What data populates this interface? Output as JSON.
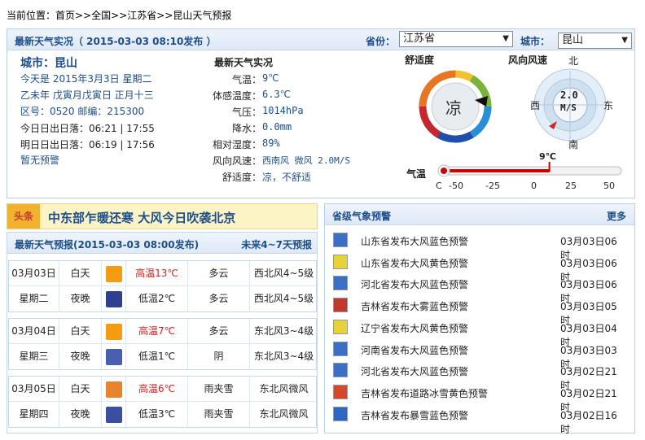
{
  "breadcrumb": {
    "prefix": "当前位置：",
    "home": "首页",
    "sep": ">>",
    "nation": "全国",
    "province": "江苏省",
    "page": "昆山天气预报"
  },
  "realtime": {
    "header": "最新天气实况（ 2015-03-03  08:10发布 ）",
    "province_label": "省份：",
    "province_value": "江苏省",
    "city_label": "城市：",
    "city_value": "昆山",
    "city_title": "城市：昆山",
    "info": [
      "今天是 2015年3月3日 星期二",
      "乙未年 戊寅月戊寅日 正月十三",
      "区号：0520  邮编：215300",
      "今日日出日落：06:21 | 17:55",
      "明日日出日落：06:19 | 17:56",
      "暂无预警"
    ],
    "obs_title": "最新天气实况",
    "obs": [
      {
        "k": "气温：",
        "v": "9℃"
      },
      {
        "k": "体感温度：",
        "v": "6.3℃"
      },
      {
        "k": "气压：",
        "v": "1014hPa"
      },
      {
        "k": "降水：",
        "v": "0.0mm"
      },
      {
        "k": "相对湿度：",
        "v": "89%"
      },
      {
        "k": "风向风速：",
        "v": "西南风 微风 2.0M/S"
      },
      {
        "k": "舒适度：",
        "v": "凉，不舒适"
      }
    ],
    "comfort_title": "舒适度",
    "comfort_value": "凉",
    "wind_title": "风向风速",
    "wind_value": "2.0",
    "wind_unit": "M/S",
    "compass": {
      "n": "北",
      "s": "南",
      "e": "东",
      "w": "西"
    },
    "temp_label": "气温",
    "temp_now": "9℃",
    "temp_now_value": 9,
    "temp_ticks": [
      "C",
      "-50",
      "-25",
      "0",
      "25",
      "50"
    ],
    "colors": {
      "header_text": "#1d4e8a",
      "high": "#d21f1f",
      "gauge_red": "#cc0000"
    }
  },
  "headline": {
    "tag": "头条",
    "text": "中东部乍暖还寒  大风今日吹袭北京"
  },
  "forecast": {
    "header": "最新天气预报(2015-03-03  08:00发布)",
    "more": "未来4~7天预报",
    "days": [
      {
        "date": "03月03日",
        "week": "星期二",
        "day": {
          "label": "白天",
          "icon": "sunny-cloudy-icon",
          "temp": "高温13℃",
          "wx": "多云",
          "wind": "西北风4~5级"
        },
        "night": {
          "label": "夜晚",
          "icon": "moon-icon",
          "temp": "低温2℃",
          "wx": "多云",
          "wind": "西北风4~5级"
        }
      },
      {
        "date": "03月04日",
        "week": "星期三",
        "day": {
          "label": "白天",
          "icon": "sunny-cloudy-icon",
          "temp": "高温7℃",
          "wx": "多云",
          "wind": "东北风3~4级"
        },
        "night": {
          "label": "夜晚",
          "icon": "cloud-night-icon",
          "temp": "低温1℃",
          "wx": "阴",
          "wind": "东北风3~4级"
        }
      },
      {
        "date": "03月05日",
        "week": "星期四",
        "day": {
          "label": "白天",
          "icon": "sleet-day-icon",
          "temp": "高温6℃",
          "wx": "雨夹雪",
          "wind": "东北风微风"
        },
        "night": {
          "label": "夜晚",
          "icon": "sleet-night-icon",
          "temp": "低温3℃",
          "wx": "雨夹雪",
          "wind": "东北风微风"
        }
      }
    ]
  },
  "warnings": {
    "header": "省级气象预警",
    "more": "更多",
    "items": [
      {
        "icon": "blue-wind-icon",
        "text": "山东省发布大风蓝色预警",
        "time": "03月03日06时"
      },
      {
        "icon": "yellow-wind-icon",
        "text": "山东省发布大风黄色预警",
        "time": "03月03日06时"
      },
      {
        "icon": "blue-wind-icon",
        "text": "河北省发布大风蓝色预警",
        "time": "03月03日06时"
      },
      {
        "icon": "fog-warning-icon",
        "text": "吉林省发布大雾蓝色预警",
        "time": "03月03日05时"
      },
      {
        "icon": "yellow-wind-icon",
        "text": "辽宁省发布大风黄色预警",
        "time": "03月03日04时"
      },
      {
        "icon": "blue-wind-icon",
        "text": "河南省发布大风蓝色预警",
        "time": "03月03日03时"
      },
      {
        "icon": "blue-wind-icon",
        "text": "河北省发布大风蓝色预警",
        "time": "03月02日21时"
      },
      {
        "icon": "ice-warning-icon",
        "text": "吉林省发布道路冰雪黄色预警",
        "time": "03月02日21时"
      },
      {
        "icon": "snow-warning-icon",
        "text": "吉林省发布暴雪蓝色预警",
        "time": "03月02日16时"
      }
    ]
  }
}
